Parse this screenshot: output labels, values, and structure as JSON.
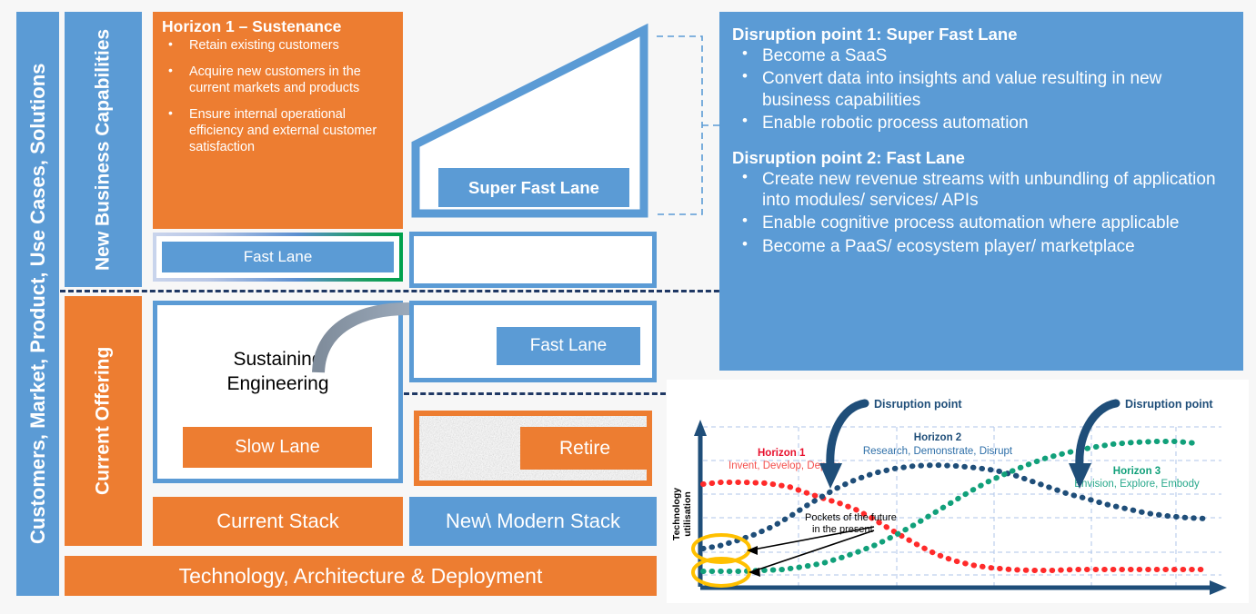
{
  "colors": {
    "blue": "#5B9BD5",
    "orange": "#ED7D31",
    "green": "#00A14B",
    "navy": "#1F3864",
    "chart_blue": "#1F4E79",
    "chart_red": "#FF2A2A",
    "chart_green": "#11A07A",
    "chart_yellow": "#FFC000",
    "background": "#F7F7F7"
  },
  "spine": {
    "label": "Customers, Market, Product, Use Cases, Solutions"
  },
  "rows": {
    "new_business_capabilities": "New Business Capabilities",
    "current_offering": "Current Offering"
  },
  "horizon1": {
    "title": "Horizon 1 – Sustenance",
    "bullets": [
      "Retain existing customers",
      "Acquire new customers in the current markets and products",
      "Ensure internal operational efficiency and external customer satisfaction"
    ]
  },
  "lanes": {
    "fast_lane_top": "Fast Lane",
    "super_fast_lane": "Super Fast Lane",
    "fast_lane_mid": "Fast Lane",
    "slow_lane": "Slow Lane",
    "retire": "Retire",
    "sustaining_engineering_line1": "Sustaining",
    "sustaining_engineering_line2": "Engineering"
  },
  "stacks": {
    "current": "Current Stack",
    "modern": "New\\ Modern Stack",
    "foundation": "Technology, Architecture & Deployment"
  },
  "right_panel": {
    "groups": [
      {
        "title": "Disruption point 1: Super Fast Lane",
        "bullets": [
          "Become a SaaS",
          "Convert data into insights and value resulting in new business capabilities",
          "Enable robotic process automation"
        ]
      },
      {
        "title": "Disruption point 2: Fast Lane",
        "bullets": [
          "Create new revenue streams with unbundling of application into modules/ services/ APIs",
          "Enable cognitive process automation where applicable",
          "Become a PaaS/ ecosystem player/ marketplace"
        ]
      }
    ]
  },
  "chart_data": {
    "type": "line",
    "title": "",
    "xlabel": "",
    "ylabel": "Technology utilisation",
    "grid": true,
    "legend_position": "inline-annotations",
    "x": [
      0,
      10,
      20,
      30,
      40,
      50,
      60,
      70,
      80,
      90,
      100
    ],
    "series": [
      {
        "name": "Horizon 1",
        "sublabel": "Invent, Develop, Deploy",
        "color": "#FF2A2A",
        "style": "dotted",
        "values": [
          70,
          69,
          67,
          63,
          56,
          45,
          32,
          22,
          16,
          14,
          14
        ]
      },
      {
        "name": "Horizon 2",
        "sublabel": "Research, Demonstrate, Disrupt",
        "color": "#1F4E79",
        "style": "dotted",
        "values": [
          13,
          24,
          38,
          53,
          66,
          75,
          78,
          76,
          68,
          56,
          45
        ]
      },
      {
        "name": "Horizon 3",
        "sublabel": "Envision, Explore, Embody",
        "color": "#11A07A",
        "style": "dotted",
        "values": [
          6,
          7,
          9,
          13,
          22,
          36,
          53,
          69,
          81,
          88,
          89
        ]
      }
    ],
    "annotations": [
      {
        "text": "Disruption point",
        "type": "arrow-callout",
        "at_x": 30,
        "at_y": 60
      },
      {
        "text": "Disruption point",
        "type": "arrow-callout",
        "at_x": 70,
        "at_y": 72
      },
      {
        "text": "Pockets of the future in the present",
        "type": "highlight-callout",
        "targets": 2
      }
    ],
    "highlights": [
      {
        "series": "Horizon 2",
        "shape": "ellipse",
        "color": "#FFC000"
      },
      {
        "series": "Horizon 3",
        "shape": "ellipse",
        "color": "#FFC000"
      }
    ],
    "ylim": [
      0,
      100
    ],
    "xlim": [
      0,
      100
    ]
  },
  "chart_text": {
    "disruption_point_1": "Disruption point",
    "disruption_point_2": "Disruption point",
    "h1_name": "Horizon 1",
    "h1_sub": "Invent, Develop, Deploy",
    "h2_name": "Horizon 2",
    "h2_sub": "Research, Demonstrate, Disrupt",
    "h3_name": "Horizon 3",
    "h3_sub": "Envision, Explore, Embody",
    "pockets_line1": "Pockets of the future",
    "pockets_line2": "in the present",
    "yaxis_line1": "Technology",
    "yaxis_line2": "utilisation"
  }
}
